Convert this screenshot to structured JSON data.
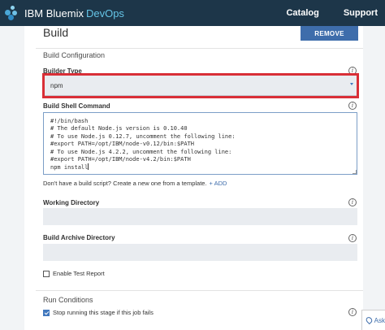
{
  "header": {
    "brand": "IBM Bluemix",
    "product": "DevOps",
    "nav": [
      "Catalog",
      "Support"
    ]
  },
  "page": {
    "title": "Build",
    "remove_label": "REMOVE"
  },
  "builder_config": {
    "section_title": "Build Configuration",
    "builder_type_label": "Builder Type",
    "builder_type_value": "npm",
    "shell_label": "Build Shell Command",
    "shell_lines": [
      "#!/bin/bash",
      "# The default Node.js version is 0.10.40",
      "# To use Node.js 0.12.7, uncomment the following line:",
      "#export PATH=/opt/IBM/node-v0.12/bin:$PATH",
      "# To use Node.js 4.2.2, uncomment the following line:",
      "#export PATH=/opt/IBM/node-v4.2/bin:$PATH",
      "npm install"
    ],
    "template_hint": "Don't have a build script? Create a new one from a template.",
    "add_label": "ADD",
    "working_dir_label": "Working Directory",
    "working_dir_value": "",
    "archive_dir_label": "Build Archive Directory",
    "archive_dir_value": "",
    "test_report_label": "Enable Test Report",
    "test_report_checked": false
  },
  "run_conditions": {
    "section_title": "Run Conditions",
    "stop_label": "Stop running this stage if this job fails",
    "stop_checked": true
  },
  "help": {
    "ask_label": "Ask"
  },
  "colors": {
    "topbar": "#1d3649",
    "devops_accent": "#65c4e6",
    "primary": "#3e6dab",
    "highlight": "#d92f37",
    "field_bg": "#e9ecf0"
  }
}
